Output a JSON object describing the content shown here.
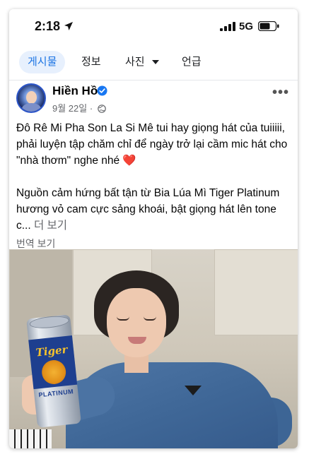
{
  "status_bar": {
    "time": "2:18",
    "network": "5G"
  },
  "tabs": [
    {
      "label": "게시물",
      "active": true
    },
    {
      "label": "정보",
      "active": false
    },
    {
      "label": "사진",
      "active": false
    },
    {
      "label": "언급",
      "active": false
    }
  ],
  "post": {
    "author": "Hiền Hồ",
    "date": "9월 22일",
    "meta_separator": "·",
    "paragraph1": "Đô Rê Mi Pha Son La Si Mê tui hay giọng hát của tuiiiii, phải luyện tập chăm chỉ để ngày trở lại cầm mic hát cho \"nhà thơm\" nghe nhé ❤️",
    "paragraph2": "Nguồn cảm hứng bất tận từ Bia Lúa Mì Tiger Platinum hương vỏ cam cực sảng khoái, bật giọng hát lên tone c...",
    "see_more": "더 보기",
    "translate": "번역 보기",
    "more_icon": "more-horizontal-icon"
  },
  "photo": {
    "can_brand": "Tiger",
    "can_subtext": "PLATINUM"
  },
  "colors": {
    "accent": "#1b74e4",
    "tab_active_bg": "#e7f0fd",
    "meta_text": "#65676b",
    "verified": "#1877f2"
  }
}
